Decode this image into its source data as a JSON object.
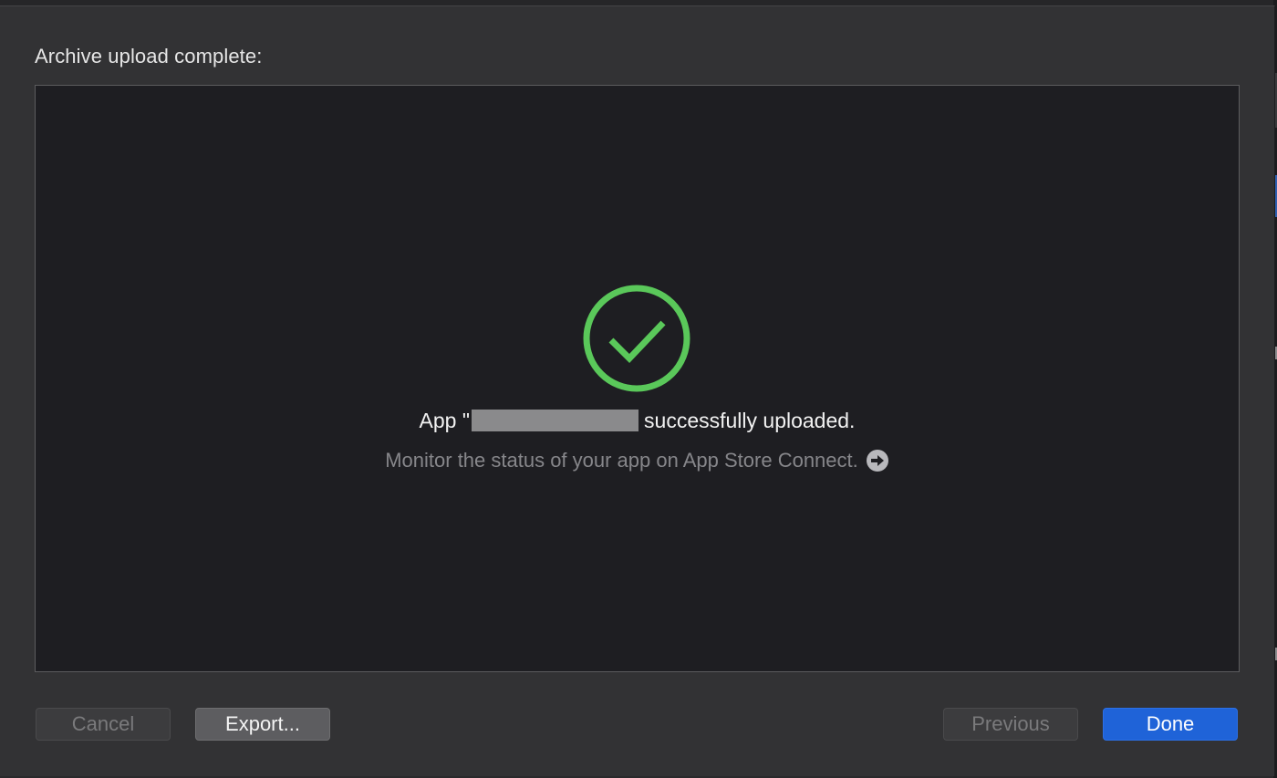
{
  "dialog": {
    "title": "Archive upload complete:",
    "status_icon": "checkmark-circle-icon",
    "headline_prefix": "App \"",
    "headline_suffix": "successfully uploaded.",
    "subline": "Monitor the status of your app on App Store Connect.",
    "subline_icon": "arrow-right-circle-icon"
  },
  "buttons": {
    "cancel": "Cancel",
    "export": "Export...",
    "previous": "Previous",
    "done": "Done"
  },
  "colors": {
    "success": "#5ac85a",
    "primary": "#1f63d8"
  }
}
